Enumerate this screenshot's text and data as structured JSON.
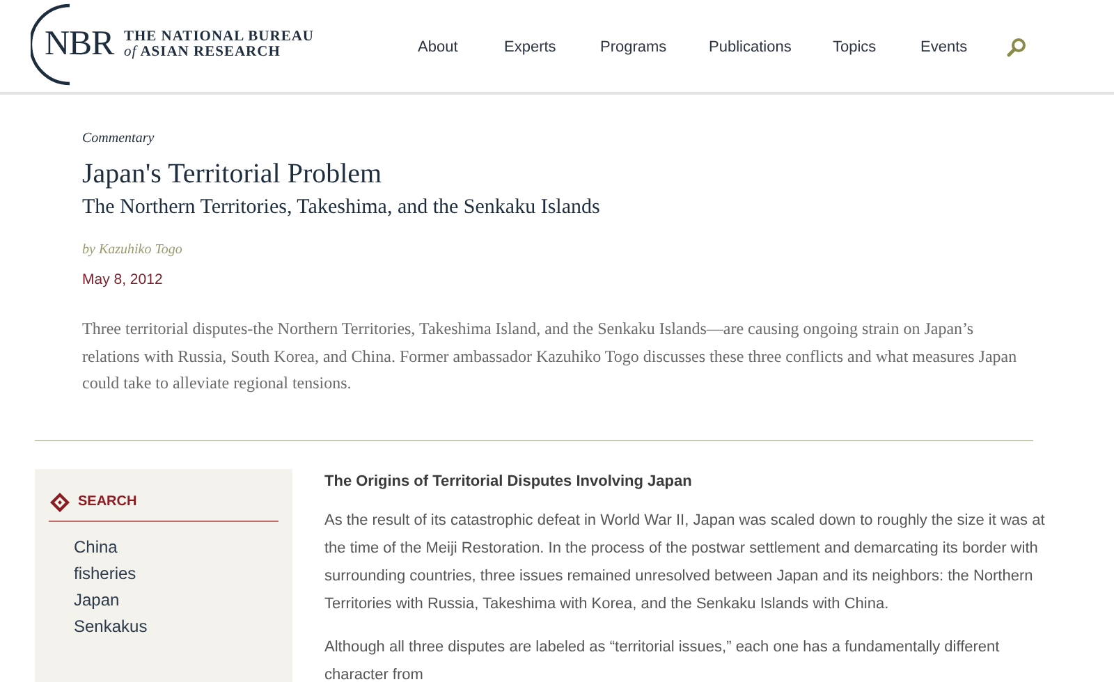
{
  "header": {
    "logo_mark": "NBR",
    "logo_line_1": "THE NATIONAL BUREAU",
    "logo_line_2_italic": "of",
    "logo_line_2": "ASIAN RESEARCH",
    "nav": [
      "About",
      "Experts",
      "Programs",
      "Publications",
      "Topics",
      "Events"
    ]
  },
  "article": {
    "category": "Commentary",
    "title": "Japan's Territorial Problem",
    "subtitle": "The Northern Territories, Takeshima, and the Senkaku Islands",
    "byline": "by Kazuhiko Togo",
    "date": "May 8, 2012",
    "summary": "Three territorial disputes-the Northern Territories, Takeshima Island, and the Senkaku Islands—are causing ongoing strain on Japan’s relations with Russia, South Korea, and China. Former ambassador Kazuhiko Togo discusses these three conflicts and what measures Japan could take to alleviate regional tensions."
  },
  "sidebar": {
    "heading": "SEARCH",
    "items": [
      "China",
      "fisheries",
      "Japan",
      "Senkakus"
    ]
  },
  "body": {
    "heading": "The Origins of Territorial Disputes Involving Japan",
    "paragraphs": [
      "As the result of its catastrophic defeat in World War II, Japan was scaled down to roughly the size it was at the time of the Meiji Restoration. In the process of the postwar settlement and demarcating its border with surrounding countries, three issues remained unresolved between Japan and its neighbors: the Northern Territories with Russia, Takeshima with Korea, and the Senkaku Islands with China.",
      "Although all three disputes are labeled as “territorial issues,” each one has a fundamentally different character from"
    ]
  }
}
